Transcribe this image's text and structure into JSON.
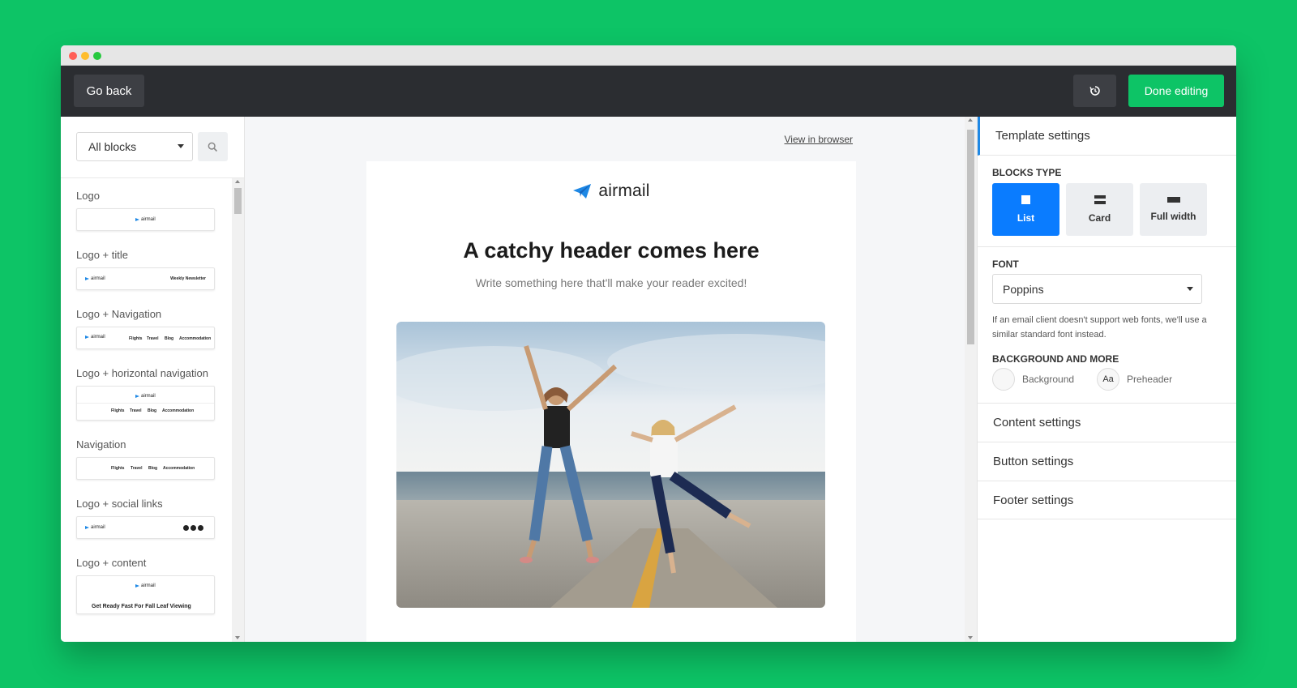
{
  "colors": {
    "background": "#0dc466",
    "toolbar": "#2b2d31",
    "accent_green": "#0dc466",
    "accent_blue": "#0a7cff"
  },
  "toolbar": {
    "back_label": "Go back",
    "history_icon": "history-icon",
    "done_label": "Done editing"
  },
  "sidebar": {
    "filter_value": "All blocks",
    "search_icon": "search-icon",
    "blocks": [
      {
        "label": "Logo",
        "thumb": {
          "logo": "airmail"
        }
      },
      {
        "label": "Logo + title",
        "thumb": {
          "logo": "airmail",
          "title": "Weekly Newsletter"
        }
      },
      {
        "label": "Logo + Navigation",
        "thumb": {
          "logo": "airmail",
          "nav": [
            "Flights",
            "Travel",
            "Blog",
            "Accommodation"
          ]
        }
      },
      {
        "label": "Logo + horizontal navigation",
        "thumb": {
          "logo": "airmail",
          "nav": [
            "Flights",
            "Travel",
            "Blog",
            "Accommodation"
          ]
        }
      },
      {
        "label": "Navigation",
        "thumb": {
          "nav": [
            "Flights",
            "Travel",
            "Blog",
            "Accommodation"
          ]
        }
      },
      {
        "label": "Logo + social links",
        "thumb": {
          "logo": "airmail"
        }
      },
      {
        "label": "Logo + content",
        "thumb": {
          "logo": "airmail",
          "title": "Get Ready Fast For Fall Leaf Viewing"
        }
      }
    ]
  },
  "canvas": {
    "view_in_browser": "View in browser",
    "logo_text": "airmail",
    "headline": "A catchy header comes here",
    "subline": "Write something here that'll make your reader excited!"
  },
  "panel": {
    "title": "Template settings",
    "blocks_type_label": "BLOCKS TYPE",
    "blocks_types": [
      {
        "label": "List",
        "icon": "square-icon",
        "active": true
      },
      {
        "label": "Card",
        "icon": "card-icon",
        "active": false
      },
      {
        "label": "Full width",
        "icon": "full-width-icon",
        "active": false
      }
    ],
    "font_label": "FONT",
    "font_value": "Poppins",
    "font_note": "If an email client doesn't support web fonts, we'll use a similar standard font instead.",
    "background_label": "BACKGROUND AND MORE",
    "background_item": "Background",
    "preheader_icon_text": "Aa",
    "preheader_item": "Preheader",
    "sections": [
      "Content settings",
      "Button settings",
      "Footer settings"
    ]
  }
}
